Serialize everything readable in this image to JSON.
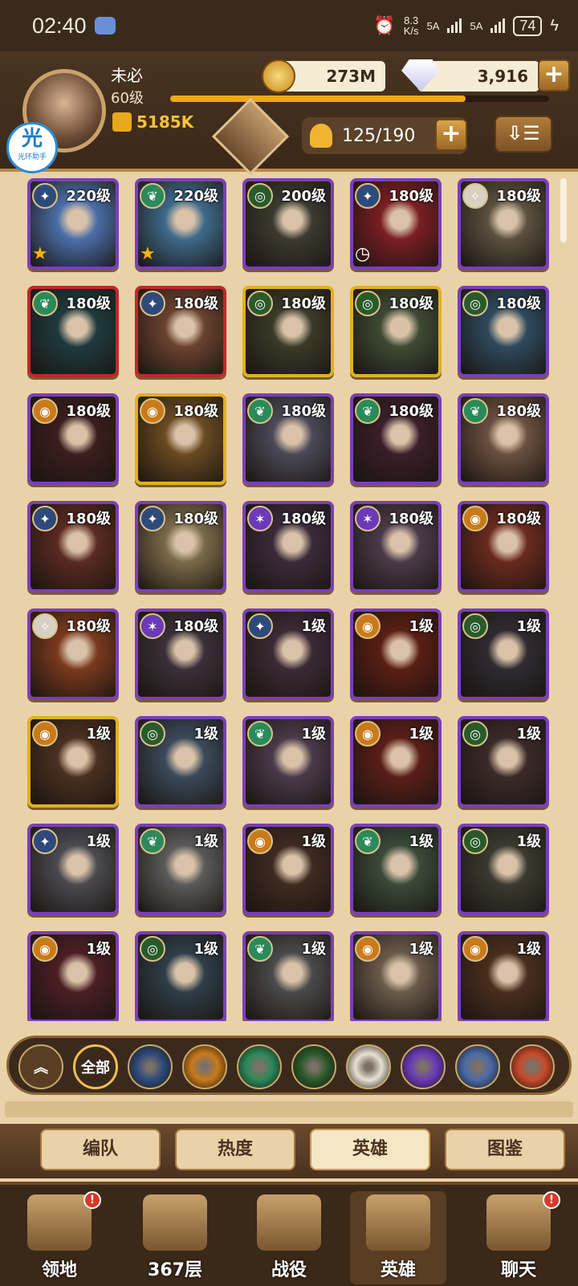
{
  "status_bar": {
    "time": "02:40",
    "net_speed_top": "8.3",
    "net_speed_unit": "K/s",
    "signal1": "5A",
    "signal2": "5A",
    "battery": "74"
  },
  "header": {
    "player_name": "未必",
    "player_level": "60级",
    "power": "5185K",
    "gold": "273M",
    "diamonds": "3,916",
    "roster": "125/190",
    "app_badge_char": "光",
    "app_badge_text": "光环助手",
    "exp_progress": 0.78
  },
  "heroes": [
    {
      "level": "220级",
      "faction": "lightbearer",
      "frame": "purple",
      "tag": "star",
      "color": "#4a6ea8"
    },
    {
      "level": "220级",
      "faction": "wilder",
      "frame": "purple",
      "tag": "star",
      "color": "#3e6a8a"
    },
    {
      "level": "200级",
      "faction": "graveborn",
      "frame": "purple",
      "tag": "",
      "color": "#3a3a30"
    },
    {
      "level": "180级",
      "faction": "lightbearer",
      "frame": "purple",
      "tag": "clock",
      "color": "#7a1e24"
    },
    {
      "level": "180级",
      "faction": "celestial",
      "frame": "purple",
      "tag": "",
      "color": "#5a5040"
    },
    {
      "level": "180级",
      "faction": "wilder",
      "frame": "red",
      "tag": "",
      "color": "#1e3a3e"
    },
    {
      "level": "180级",
      "faction": "lightbearer",
      "frame": "red",
      "tag": "",
      "color": "#6a4230"
    },
    {
      "level": "180级",
      "faction": "graveborn",
      "frame": "gold",
      "tag": "",
      "color": "#3a3a28"
    },
    {
      "level": "180级",
      "faction": "graveborn",
      "frame": "gold",
      "tag": "",
      "color": "#3e4a34"
    },
    {
      "level": "180级",
      "faction": "graveborn",
      "frame": "purple",
      "tag": "",
      "color": "#2e4a5e"
    },
    {
      "level": "180级",
      "faction": "mauler",
      "frame": "purple",
      "tag": "",
      "color": "#3a1e1e"
    },
    {
      "level": "180级",
      "faction": "mauler",
      "frame": "gold",
      "tag": "",
      "color": "#6a4a22"
    },
    {
      "level": "180级",
      "faction": "wilder",
      "frame": "purple",
      "tag": "",
      "color": "#4a4a58"
    },
    {
      "level": "180级",
      "faction": "wilder",
      "frame": "purple",
      "tag": "",
      "color": "#3a1e2a"
    },
    {
      "level": "180级",
      "faction": "wilder",
      "frame": "purple",
      "tag": "",
      "color": "#6a5040"
    },
    {
      "level": "180级",
      "faction": "lightbearer",
      "frame": "purple",
      "tag": "",
      "color": "#5a2a22"
    },
    {
      "level": "180级",
      "faction": "lightbearer",
      "frame": "purple",
      "tag": "",
      "color": "#7a6a4a"
    },
    {
      "level": "180级",
      "faction": "hypogean",
      "frame": "purple",
      "tag": "",
      "color": "#3a2a3a"
    },
    {
      "level": "180级",
      "faction": "hypogean",
      "frame": "purple",
      "tag": "",
      "color": "#4a3a4a"
    },
    {
      "level": "180级",
      "faction": "mauler",
      "frame": "purple",
      "tag": "",
      "color": "#6a2a1e"
    },
    {
      "level": "180级",
      "faction": "celestial",
      "frame": "purple",
      "tag": "",
      "color": "#7a3a1e"
    },
    {
      "level": "180级",
      "faction": "hypogean",
      "frame": "purple",
      "tag": "",
      "color": "#3a3038"
    },
    {
      "level": "1级",
      "faction": "lightbearer",
      "frame": "purple",
      "tag": "",
      "color": "#3a2a34"
    },
    {
      "level": "1级",
      "faction": "mauler",
      "frame": "purple",
      "tag": "",
      "color": "#5a1e14"
    },
    {
      "level": "1级",
      "faction": "graveborn",
      "frame": "purple",
      "tag": "",
      "color": "#2e2a30"
    },
    {
      "level": "1级",
      "faction": "mauler",
      "frame": "gold",
      "tag": "",
      "color": "#4a3020"
    },
    {
      "level": "1级",
      "faction": "graveborn",
      "frame": "purple",
      "tag": "",
      "color": "#3a4a5a"
    },
    {
      "level": "1级",
      "faction": "wilder",
      "frame": "purple",
      "tag": "",
      "color": "#4a3a4a"
    },
    {
      "level": "1级",
      "faction": "mauler",
      "frame": "purple",
      "tag": "",
      "color": "#5a1e18"
    },
    {
      "level": "1级",
      "faction": "graveborn",
      "frame": "purple",
      "tag": "",
      "color": "#3a2a28"
    },
    {
      "level": "1级",
      "faction": "lightbearer",
      "frame": "purple",
      "tag": "",
      "color": "#4a4a50"
    },
    {
      "level": "1级",
      "faction": "wilder",
      "frame": "purple",
      "tag": "",
      "color": "#5a5a5a"
    },
    {
      "level": "1级",
      "faction": "mauler",
      "frame": "purple",
      "tag": "",
      "color": "#3e2a20"
    },
    {
      "level": "1级",
      "faction": "wilder",
      "frame": "purple",
      "tag": "",
      "color": "#3a4a3a"
    },
    {
      "level": "1级",
      "faction": "graveborn",
      "frame": "purple",
      "tag": "",
      "color": "#3a3a30"
    },
    {
      "level": "1级",
      "faction": "mauler",
      "frame": "purple",
      "tag": "",
      "color": "#4a1e24"
    },
    {
      "level": "1级",
      "faction": "graveborn",
      "frame": "purple",
      "tag": "",
      "color": "#2e3e48"
    },
    {
      "level": "1级",
      "faction": "wilder",
      "frame": "purple",
      "tag": "",
      "color": "#4a4a4a"
    },
    {
      "level": "1级",
      "faction": "mauler",
      "frame": "purple",
      "tag": "",
      "color": "#6a5a4a"
    },
    {
      "level": "1级",
      "faction": "mauler",
      "frame": "purple",
      "tag": "",
      "color": "#4a2e1e"
    }
  ],
  "filters": {
    "collapse": "collapse-icon",
    "all_label": "全部",
    "factions": [
      {
        "name": "lightbearer-filter-icon",
        "color": "#2e4a7a"
      },
      {
        "name": "mauler-filter-icon",
        "color": "#c97a1a"
      },
      {
        "name": "wilder-filter-icon",
        "color": "#2a8a5a"
      },
      {
        "name": "graveborn-filter-icon",
        "color": "#2a5a2a"
      },
      {
        "name": "celestial-filter-icon",
        "color": "#e8e0d0"
      },
      {
        "name": "hypogean-filter-icon",
        "color": "#6a3ab8"
      },
      {
        "name": "dimensional-filter-icon",
        "color": "#4a6aa8"
      },
      {
        "name": "fire-filter-icon",
        "color": "#c94a2a"
      }
    ]
  },
  "subtabs": [
    "编队",
    "热度",
    "英雄",
    "图鉴"
  ],
  "bottom_nav": [
    {
      "label": "领地",
      "badge": "!"
    },
    {
      "label": "367层",
      "badge": ""
    },
    {
      "label": "战役",
      "badge": ""
    },
    {
      "label": "英雄",
      "badge": ""
    },
    {
      "label": "聊天",
      "badge": "!"
    }
  ],
  "colors": {
    "frame_purple": "#7a3fb8",
    "frame_red": "#c0282a",
    "frame_gold": "#e0b020",
    "lightbearer": "#2e4a7a",
    "mauler": "#c97a1a",
    "wilder": "#2a8a5a",
    "graveborn": "#2a5a2a",
    "celestial": "#d8d0c0",
    "hypogean": "#6a3ab8"
  }
}
